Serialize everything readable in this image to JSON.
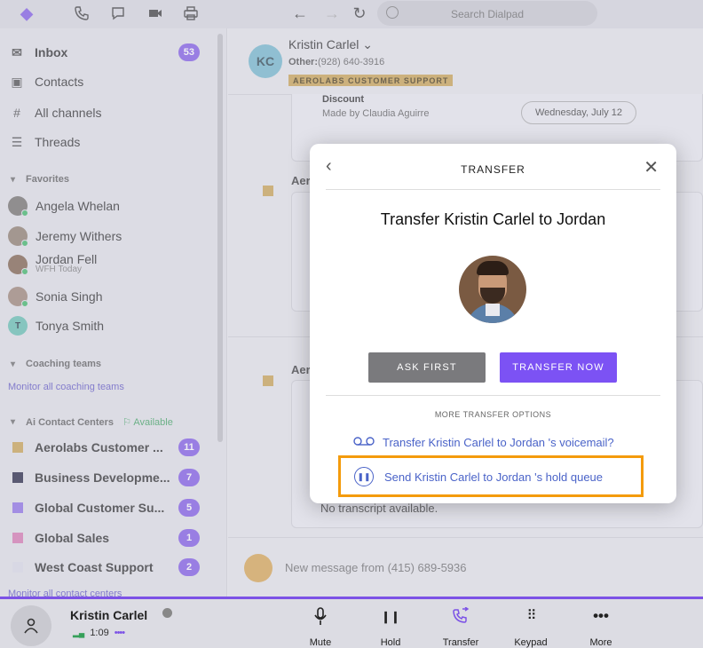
{
  "search": {
    "placeholder": "Search Dialpad"
  },
  "sidebar": {
    "inbox": {
      "label": "Inbox",
      "count": "53"
    },
    "contacts": "Contacts",
    "all_channels": "All channels",
    "threads": "Threads",
    "favorites_header": "Favorites",
    "favorites": [
      {
        "name": "Angela Whelan",
        "status": ""
      },
      {
        "name": "Jeremy Withers",
        "status": ""
      },
      {
        "name": "Jordan Fell",
        "status": "WFH Today"
      },
      {
        "name": "Sonia Singh",
        "status": ""
      },
      {
        "name": "Tonya Smith",
        "status": "",
        "initial": "T"
      }
    ],
    "coaching_header": "Coaching teams",
    "coaching_link": "Monitor all coaching teams",
    "cc_header": "Ai Contact Centers",
    "cc_status": "Available",
    "contact_centers": [
      {
        "name": "Aerolabs Customer ...",
        "count": "11",
        "color": "#c9a04a"
      },
      {
        "name": "Business Developme...",
        "count": "7",
        "color": "#1a1a3a"
      },
      {
        "name": "Global Customer Su...",
        "count": "5",
        "color": "#8a6ae6"
      },
      {
        "name": "Global Sales",
        "count": "1",
        "color": "#d874b0"
      },
      {
        "name": "West Coast Support",
        "count": "2",
        "color": "#dcdce8"
      }
    ],
    "cc_link": "Monitor all contact centers"
  },
  "contact": {
    "initials": "KC",
    "name": "Kristin Carlel",
    "phone_label": "Other:",
    "phone": "(928) 640-3916",
    "tag": "AEROLABS CUSTOMER SUPPORT"
  },
  "timeline": {
    "discount_title": "Discount",
    "discount_sub": "Made by Claudia Aguirre",
    "date": "Wednesday, July 12",
    "aer_label_1": "Aer",
    "aer_label_2": "Aer",
    "no_transcript": "No transcript available.",
    "new_message": "New message from (415) 689-5936"
  },
  "modal": {
    "title": "TRANSFER",
    "heading": "Transfer Kristin Carlel to Jordan",
    "ask_first": "ASK FIRST",
    "transfer_now": "TRANSFER NOW",
    "more_options": "MORE TRANSFER OPTIONS",
    "option_voicemail": "Transfer Kristin Carlel to Jordan 's voicemail?",
    "option_hold": "Send Kristin Carlel to Jordan 's hold queue"
  },
  "callbar": {
    "caller": "Kristin Carlel",
    "timer": "1:09",
    "controls": {
      "mute": "Mute",
      "hold": "Hold",
      "transfer": "Transfer",
      "keypad": "Keypad",
      "more": "More"
    }
  },
  "colors": {
    "accent": "#7c52f4",
    "highlight": "#f49b0c",
    "link": "#4a63c8"
  }
}
